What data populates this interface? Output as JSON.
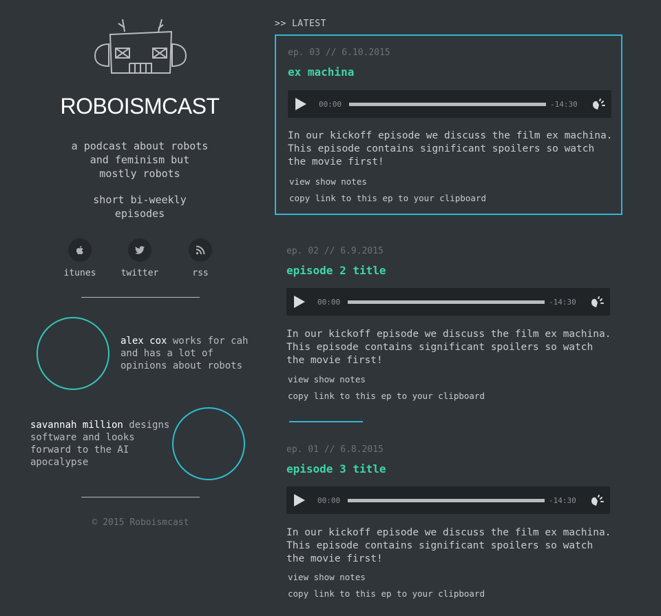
{
  "site": {
    "title": "ROBOISMCAST",
    "tagline": "a podcast about robots and feminism but mostly robots",
    "schedule": "short bi-weekly episodes",
    "footer": "© 2015 Roboismcast"
  },
  "social": [
    {
      "label": "itunes",
      "icon": "apple-icon"
    },
    {
      "label": "twitter",
      "icon": "twitter-icon"
    },
    {
      "label": "rss",
      "icon": "rss-icon"
    }
  ],
  "hosts": [
    {
      "name": "alex cox",
      "bio": "works for cah and has a lot of opinions about robots"
    },
    {
      "name": "savannah million",
      "bio": "designs software and looks forward to the AI apocalypse"
    }
  ],
  "main": {
    "section_label": ">> LATEST",
    "episodes": [
      {
        "meta": "ep. 03 // 6.10.2015",
        "title": "ex machina",
        "current_time": "00:00",
        "remaining_time": "-14:30",
        "description": "In our kickoff episode we discuss the film ex machina. This episode contains significant spoilers so watch the movie first!",
        "notes_link": "view show notes",
        "copy_link": "copy link to this ep to your clipboard"
      },
      {
        "meta": "ep. 02 // 6.9.2015",
        "title": "episode 2 title",
        "current_time": "00:00",
        "remaining_time": "-14:30",
        "description": "In our kickoff episode we discuss the film ex machina. This episode contains significant spoilers so watch the movie first!",
        "notes_link": "view show notes",
        "copy_link": "copy link to this ep to your clipboard"
      },
      {
        "meta": "ep. 01 // 6.8.2015",
        "title": "episode 3 title",
        "current_time": "00:00",
        "remaining_time": "-14:30",
        "description": "In our kickoff episode we discuss the film ex machina. This episode contains significant spoilers so watch the movie first!",
        "notes_link": "view show notes",
        "copy_link": "copy link to this ep to your clipboard"
      }
    ]
  },
  "colors": {
    "background": "#30353a",
    "accent_green": "#3ed6a7",
    "accent_blue": "#33b5d4",
    "player_bg": "#202427"
  }
}
